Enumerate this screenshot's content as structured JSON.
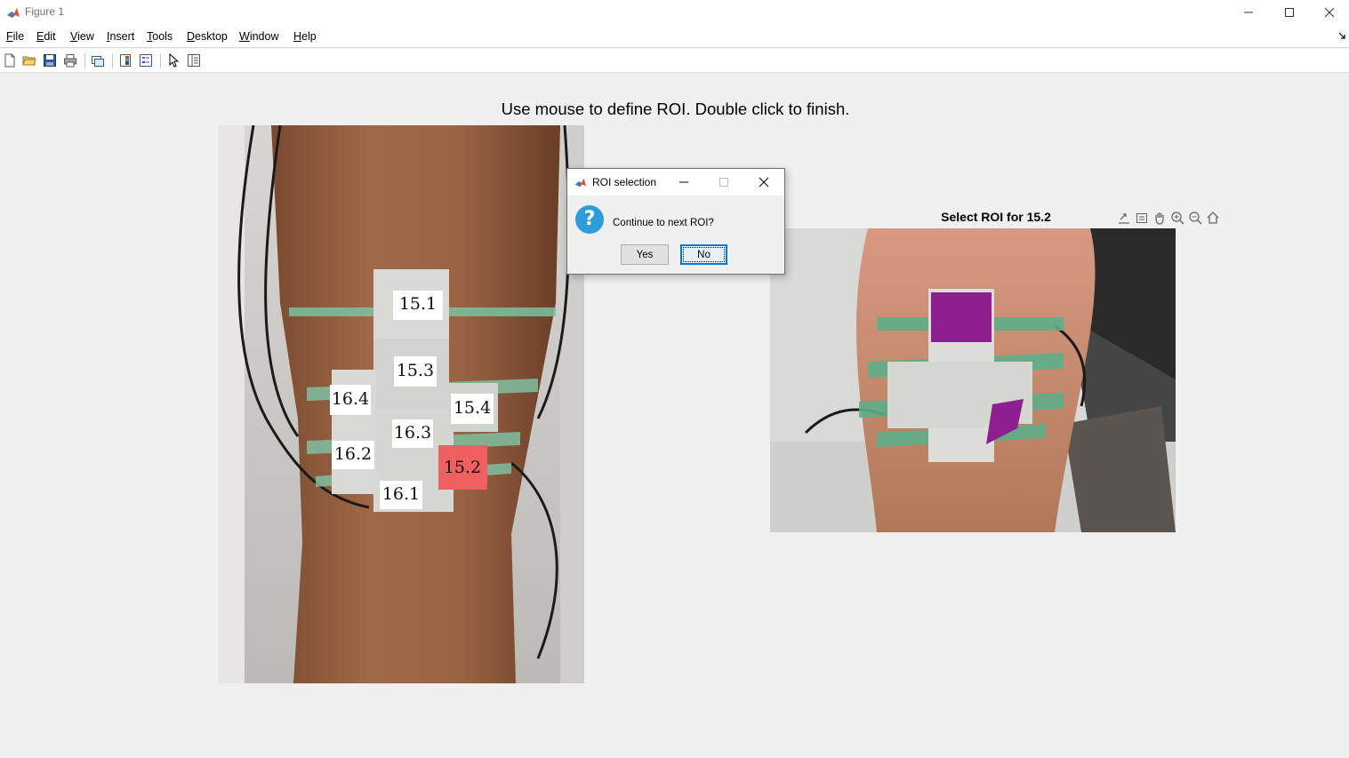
{
  "window": {
    "title": "Figure 1",
    "controls": [
      "minimize-icon",
      "maximize-icon",
      "close-icon"
    ]
  },
  "menubar": {
    "items": [
      {
        "label": "File"
      },
      {
        "label": "Edit"
      },
      {
        "label": "View"
      },
      {
        "label": "Insert"
      },
      {
        "label": "Tools"
      },
      {
        "label": "Desktop"
      },
      {
        "label": "Window"
      },
      {
        "label": "Help"
      }
    ]
  },
  "toolbar": {
    "icons": [
      "new-figure-icon",
      "open-file-icon",
      "save-icon",
      "print-icon",
      "link-plot-icon",
      "colorbar-icon",
      "legend-icon",
      "edit-plot-arrow-icon",
      "property-inspector-icon"
    ]
  },
  "figure": {
    "main_title": "Use mouse to define ROI. Double click to finish.",
    "left_labels": [
      "15.1",
      "15.3",
      "16.4",
      "15.4",
      "16.3",
      "16.2",
      "15.2",
      "16.1"
    ],
    "highlighted_label": "15.2",
    "right_axes_title": "Select ROI for 15.2",
    "axes_tools": [
      "export-icon",
      "brush-icon",
      "pan-icon",
      "zoom-in-icon",
      "zoom-out-icon",
      "home-icon"
    ],
    "roi_color": "#8e1f8e",
    "highlight_color": "#f06060"
  },
  "dialog": {
    "title": "ROI selection",
    "message": "Continue to next ROI?",
    "yes_label": "Yes",
    "no_label": "No"
  }
}
